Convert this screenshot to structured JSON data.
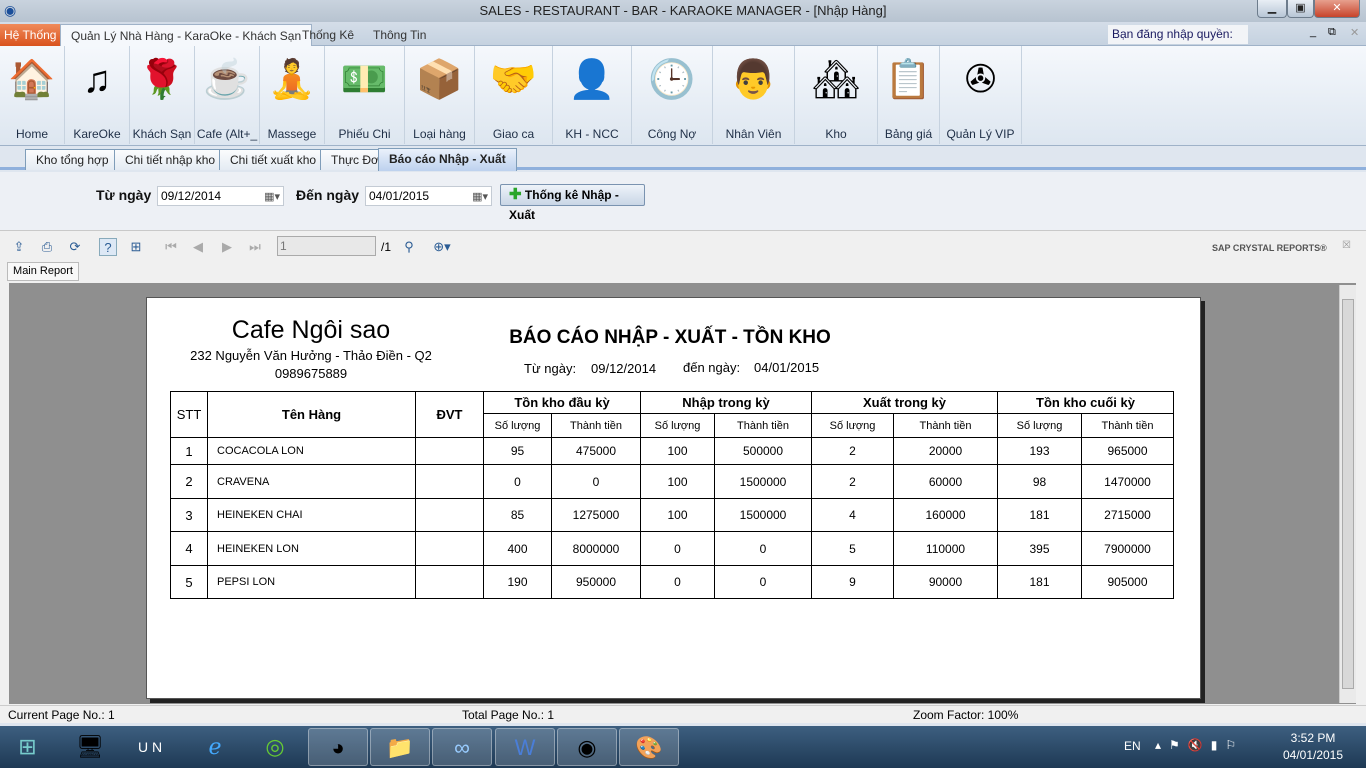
{
  "window": {
    "title": "SALES - RESTAURANT - BAR - KARAOKE MANAGER - [Nhập Hàng]",
    "minimize": "▁",
    "maximize": "▣",
    "close": "✕"
  },
  "ribbon_tabs": [
    {
      "label": "Hệ Thống"
    },
    {
      "label": "Quản Lý Nhà Hàng - KaraOke - Khách Sạn"
    },
    {
      "label": "Thống Kê"
    },
    {
      "label": "Thông Tin"
    }
  ],
  "login_text": "Bạn đăng nhập quyền: admin",
  "ribbon_items": [
    {
      "label": "Home",
      "icon": "home-icon",
      "glyph": "🏠"
    },
    {
      "label": "KareOke",
      "icon": "music-note-icon",
      "glyph": "♫"
    },
    {
      "label": "Khách Sạn",
      "icon": "rose-icon",
      "glyph": "🌹"
    },
    {
      "label": "Cafe (Alt+_",
      "icon": "coffee-cup-icon",
      "glyph": "☕"
    },
    {
      "label": "Massege",
      "icon": "massage-icon",
      "glyph": "🧘"
    },
    {
      "label": "Phiếu Chi",
      "icon": "money-icon",
      "glyph": "💵"
    },
    {
      "label": "Loại hàng",
      "icon": "box-icon",
      "glyph": "📦"
    },
    {
      "label": "Giao ca",
      "icon": "handshake-icon",
      "glyph": "🤝"
    },
    {
      "label": "KH - NCC",
      "icon": "businessman-icon",
      "glyph": "👤"
    },
    {
      "label": "Công Nợ",
      "icon": "clock-icon",
      "glyph": "🕒"
    },
    {
      "label": "Nhân Viên",
      "icon": "employee-icon",
      "glyph": "👨"
    },
    {
      "label": "Kho",
      "icon": "warehouse-icon",
      "glyph": "🏘"
    },
    {
      "label": "Bảng giá",
      "icon": "calendar-icon",
      "glyph": "📋"
    },
    {
      "label": "Quản Lý VIP",
      "icon": "vip-icon",
      "glyph": "✇"
    }
  ],
  "doc_tabs": [
    {
      "label": "Kho tổng hợp"
    },
    {
      "label": "Chi tiết nhập kho"
    },
    {
      "label": "Chi tiết xuất kho"
    },
    {
      "label": "Thực Đơn"
    },
    {
      "label": "Báo cáo Nhập - Xuất"
    }
  ],
  "filter": {
    "from_label": "Từ ngày",
    "from_value": "09/12/2014",
    "to_label": "Đến ngày",
    "to_value": "04/01/2015",
    "button": "Thống kê Nhập - Xuất"
  },
  "viewer": {
    "page_input": "1",
    "page_total": "/1",
    "brand": "SAP CRYSTAL REPORTS®",
    "main_tab": "Main Report"
  },
  "report": {
    "company": "Cafe Ngôi sao",
    "address": "232 Nguyễn Văn Hưởng - Thảo Điền - Q2",
    "phone": "0989675889",
    "title": "BÁO CÁO NHẬP - XUẤT - TỒN KHO",
    "from_label": "Từ ngày:",
    "from": "09/12/2014",
    "to_label": "đến ngày:",
    "to": "04/01/2015",
    "headers": {
      "stt": "STT",
      "name": "Tên Hàng",
      "unit": "ĐVT",
      "g1": "Tồn kho đầu kỳ",
      "g2": "Nhập trong kỳ",
      "g3": "Xuất trong kỳ",
      "g4": "Tồn kho cuối kỳ",
      "qty": "Số lượng",
      "amount": "Thành tiền"
    },
    "rows": [
      [
        "1",
        "COCACOLA LON",
        "",
        "95",
        "475000",
        "100",
        "500000",
        "2",
        "20000",
        "193",
        "965000"
      ],
      [
        "2",
        "CRAVENA",
        "",
        "0",
        "0",
        "100",
        "1500000",
        "2",
        "60000",
        "98",
        "1470000"
      ],
      [
        "3",
        "HEINEKEN CHAI",
        "",
        "85",
        "1275000",
        "100",
        "1500000",
        "4",
        "160000",
        "181",
        "2715000"
      ],
      [
        "4",
        "HEINEKEN LON",
        "",
        "400",
        "8000000",
        "0",
        "0",
        "5",
        "110000",
        "395",
        "7900000"
      ],
      [
        "5",
        "PEPSI LON",
        "",
        "190",
        "950000",
        "0",
        "0",
        "9",
        "90000",
        "181",
        "905000"
      ]
    ]
  },
  "status": {
    "current": "Current Page No.: 1",
    "total": "Total Page No.: 1",
    "zoom": "Zoom Factor: 100%"
  },
  "tray": {
    "lang": "EN",
    "time": "3:52 PM",
    "date": "04/01/2015"
  }
}
